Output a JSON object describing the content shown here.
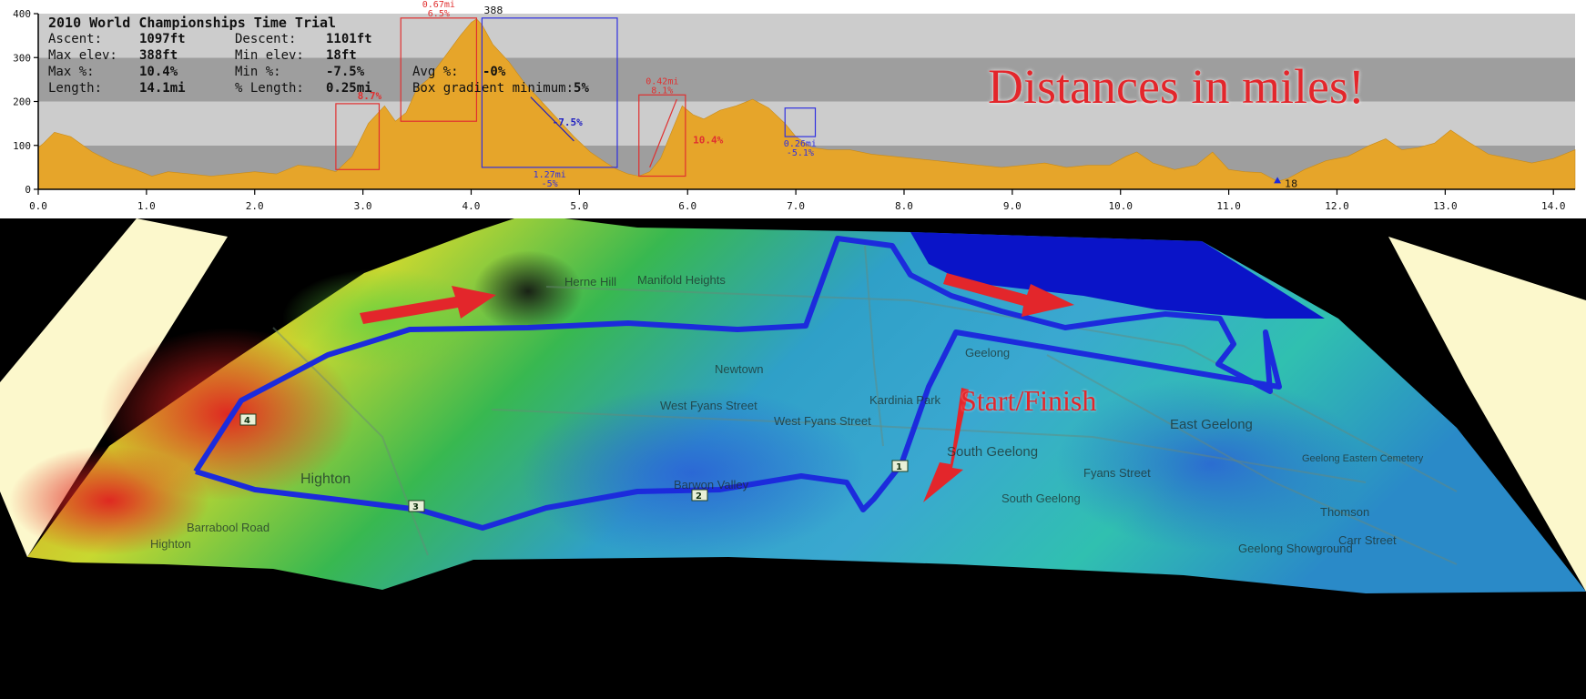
{
  "chart_data": {
    "type": "area",
    "title": "2010 World Championships Time Trial",
    "xlim": [
      0,
      14.2
    ],
    "ylim": [
      0,
      400
    ],
    "xticks": [
      "0.0",
      "1.0",
      "2.0",
      "3.0",
      "4.0",
      "5.0",
      "6.0",
      "7.0",
      "8.0",
      "9.0",
      "10.0",
      "11.0",
      "12.0",
      "13.0",
      "14.0"
    ],
    "yticks": [
      "0",
      "100",
      "200",
      "300",
      "400"
    ],
    "grid": true,
    "series": [
      {
        "x": [
          0,
          0.05,
          0.15,
          0.3,
          0.5,
          0.7,
          0.9,
          1.05,
          1.2,
          1.4,
          1.6,
          1.8,
          2.0,
          2.2,
          2.4,
          2.6,
          2.75,
          2.9,
          3.05,
          3.2,
          3.3,
          3.4,
          3.5,
          3.6,
          3.75,
          3.9,
          4.0,
          4.05,
          4.1,
          4.2,
          4.35,
          4.5,
          4.65,
          4.8,
          4.95,
          5.1,
          5.25,
          5.35,
          5.45,
          5.55,
          5.65,
          5.75,
          5.85,
          5.95,
          6.05,
          6.15,
          6.3,
          6.45,
          6.6,
          6.75,
          6.9,
          7.0,
          7.15,
          7.3,
          7.5,
          7.7,
          7.9,
          8.1,
          8.3,
          8.5,
          8.7,
          8.9,
          9.1,
          9.3,
          9.5,
          9.7,
          9.9,
          10.05,
          10.15,
          10.3,
          10.5,
          10.7,
          10.85,
          11.0,
          11.15,
          11.3,
          11.45,
          11.55,
          11.7,
          11.9,
          12.1,
          12.3,
          12.45,
          12.6,
          12.75,
          12.9,
          13.05,
          13.2,
          13.4,
          13.6,
          13.8,
          14.0,
          14.2
        ],
        "y": [
          95,
          105,
          130,
          120,
          85,
          60,
          45,
          30,
          40,
          35,
          30,
          35,
          40,
          35,
          55,
          50,
          40,
          75,
          150,
          190,
          155,
          175,
          230,
          250,
          300,
          350,
          380,
          388,
          375,
          330,
          290,
          240,
          200,
          160,
          120,
          85,
          60,
          45,
          35,
          30,
          40,
          70,
          130,
          190,
          170,
          160,
          180,
          190,
          205,
          185,
          150,
          120,
          95,
          90,
          90,
          80,
          75,
          70,
          65,
          60,
          55,
          50,
          55,
          60,
          50,
          55,
          55,
          75,
          85,
          60,
          45,
          55,
          85,
          45,
          40,
          38,
          18,
          25,
          45,
          65,
          75,
          100,
          115,
          90,
          95,
          105,
          135,
          110,
          80,
          70,
          60,
          70,
          90
        ]
      }
    ],
    "peak_label": "388",
    "min_label": "18",
    "segments": [
      {
        "label": "",
        "x0": 2.75,
        "x1": 3.15,
        "y0": 45,
        "y1": 195,
        "color": "#e03030"
      },
      {
        "label": "0.67mi",
        "grade": "6.5%",
        "x0": 3.35,
        "x1": 4.05,
        "y0": 155,
        "y1": 390,
        "color": "#e03030"
      },
      {
        "label": "1.27mi",
        "grade": "-5%",
        "x0": 4.1,
        "x1": 5.35,
        "y0": 50,
        "y1": 390,
        "color": "#3030e0"
      },
      {
        "label": "0.42mi",
        "grade": "8.1%",
        "x0": 5.55,
        "x1": 5.98,
        "y0": 30,
        "y1": 215,
        "color": "#e03030"
      },
      {
        "label": "0.26mi",
        "grade": "-5.1%",
        "x0": 6.9,
        "x1": 7.18,
        "y0": 120,
        "y1": 185,
        "color": "#3030e0"
      }
    ],
    "annotations": [
      {
        "text": "-7.5%",
        "x": 4.75,
        "y": 145,
        "color": "#2020c0"
      },
      {
        "text": "10.4%",
        "x": 6.05,
        "y": 105,
        "color": "#e03030"
      },
      {
        "text": "8.7%",
        "x": 2.95,
        "y": 205,
        "color": "#e03030"
      }
    ]
  },
  "stats": {
    "row1": {
      "l1": "Ascent:",
      "v1": "1097ft",
      "l2": "Descent:",
      "v2": "1101ft"
    },
    "row2": {
      "l1": "Max elev:",
      "v1": "388ft",
      "l2": "Min elev:",
      "v2": "18ft"
    },
    "row3": {
      "l1": "Max %:",
      "v1": "10.4%",
      "l2": "Min %:",
      "v2": "-7.5%",
      "l3": "Avg %:",
      "v3": "-0%"
    },
    "row4": {
      "l1": "Length:",
      "v1": "14.1mi",
      "l2": "% Length:",
      "v2": "0.25mi",
      "l3": "Box gradient minimum:",
      "v3": "5%"
    }
  },
  "headline": "Distances in miles!",
  "map": {
    "start_finish": "Start/Finish",
    "markers": [
      "1",
      "2",
      "3",
      "4"
    ],
    "streets": [
      "Highton",
      "Barrabool Road",
      "Highton",
      "Newtown",
      "West Fyans Street",
      "West Fyans Street",
      "Barwon Valley",
      "Kardinia Park",
      "South Geelong",
      "South Geelong",
      "Fyans Street",
      "East Geelong",
      "Thomson",
      "Geelong Showground",
      "Carr Street",
      "Geelong Eastern Cemetery",
      "Geelong",
      "Manifold Heights",
      "Herne Hill"
    ]
  },
  "colors": {
    "elevation_fill": "#e6a52a",
    "route": "#1c2bdc",
    "arrow": "#e3262b",
    "water": "#0a14c8"
  }
}
